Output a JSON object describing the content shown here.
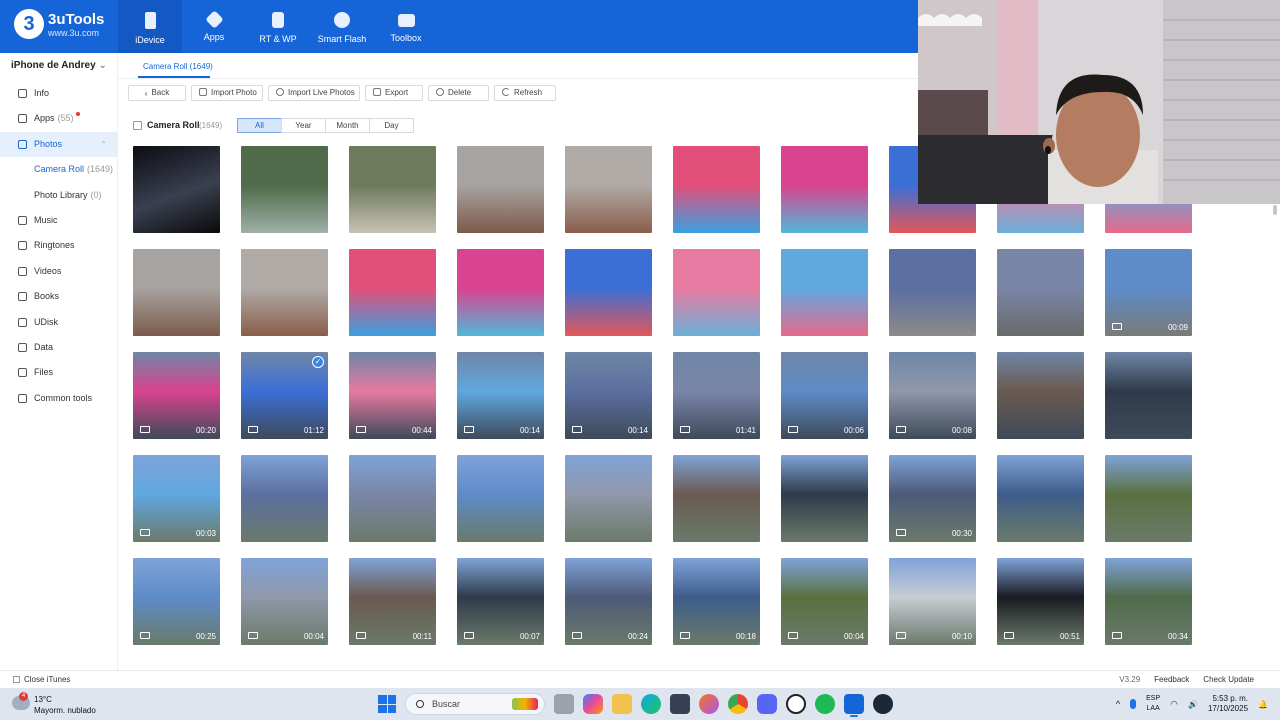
{
  "app": {
    "brand_initial": "3",
    "brand_name": "3uTools",
    "brand_url": "www.3u.com"
  },
  "nav": [
    {
      "label": "iDevice",
      "icon": "phone-icon"
    },
    {
      "label": "Apps",
      "icon": "cube-icon"
    },
    {
      "label": "RT & WP",
      "icon": "music-note-icon"
    },
    {
      "label": "Smart Flash",
      "icon": "flash-icon"
    },
    {
      "label": "Toolbox",
      "icon": "toolbox-icon"
    }
  ],
  "sidebar": {
    "device_name": "iPhone de Andrey",
    "device_chevron": "⌄",
    "items": [
      {
        "label": "Info",
        "count": "",
        "icon": "info-icon"
      },
      {
        "label": "Apps",
        "count": "(55)",
        "icon": "apps-icon",
        "dot": true
      },
      {
        "label": "Photos",
        "count": "",
        "icon": "photos-icon",
        "active": true,
        "chevron": "⌃"
      },
      {
        "label": "Camera Roll",
        "count": "(1649)",
        "sub": true,
        "active_sub": true
      },
      {
        "label": "Photo Library",
        "count": "(0)",
        "sub": true
      },
      {
        "label": "Music",
        "count": "",
        "icon": "music-icon"
      },
      {
        "label": "Ringtones",
        "count": "",
        "icon": "bell-icon"
      },
      {
        "label": "Videos",
        "count": "",
        "icon": "video-icon"
      },
      {
        "label": "Books",
        "count": "",
        "icon": "book-icon"
      },
      {
        "label": "UDisk",
        "count": "",
        "icon": "udisk-icon"
      },
      {
        "label": "Data",
        "count": "",
        "icon": "data-icon"
      },
      {
        "label": "Files",
        "count": "",
        "icon": "files-icon"
      },
      {
        "label": "Common tools",
        "count": "",
        "icon": "tools-icon"
      }
    ]
  },
  "main": {
    "tab_label": "Camera Roll (1649)",
    "toolbar": {
      "back": "Back",
      "import_photo": "Import Photo",
      "import_live": "Import Live Photos",
      "export": "Export",
      "delete": "Delete",
      "refresh": "Refresh"
    },
    "filter": {
      "album_label": "Camera Roll",
      "album_count": "(1649)",
      "segments": [
        "All",
        "Year",
        "Month",
        "Day"
      ],
      "active_segment": "All"
    },
    "thumbnails": [
      [
        "",
        "",
        "",
        "",
        "",
        "",
        "",
        "",
        "",
        ""
      ],
      [
        "",
        "",
        "",
        "",
        "",
        "",
        "",
        "",
        "",
        "00:09"
      ],
      [
        "00:20",
        "01:12",
        "00:44",
        "00:14",
        "00:14",
        "01:41",
        "00:06",
        "00:08",
        "",
        ""
      ],
      [
        "00:03",
        "",
        "",
        "",
        "",
        "",
        "",
        "00:30",
        "",
        ""
      ],
      [
        "00:25",
        "00:04",
        "00:11",
        "00:07",
        "00:24",
        "00:18",
        "00:04",
        "00:10",
        "00:51",
        "00:34"
      ]
    ]
  },
  "statusbar": {
    "close_itunes": "Close iTunes",
    "version": "V3.29",
    "feedback": "Feedback",
    "check_update": "Check Update"
  },
  "taskbar": {
    "weather_badge": "4",
    "temperature": "13°C",
    "condition": "Mayorm. nublado",
    "search_placeholder": "Buscar",
    "lang_top": "ESP",
    "lang_bottom": "LAA",
    "time": "5:53 p. m.",
    "date": "17/10/2025",
    "tray_chevron": "^",
    "wifi_glyph": "◠",
    "sound_glyph": "🔊",
    "bell_glyph": "🔔"
  },
  "colors": {
    "header_blue": "#1565d8",
    "active_bg": "#e6effc",
    "taskbar_bg": "#dfe5ef"
  }
}
